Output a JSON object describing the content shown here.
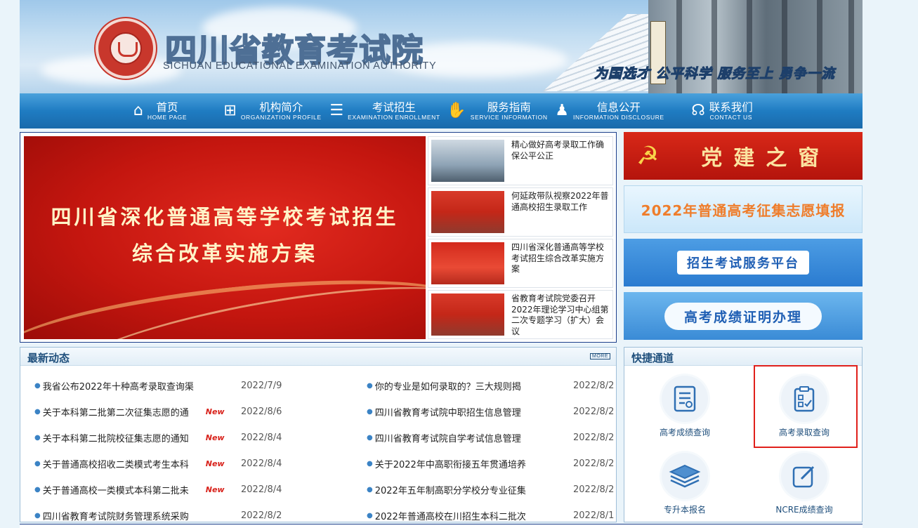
{
  "header": {
    "title": "四川省教育考试院",
    "subtitle": "SICHUAN EDUCATIONAL EXAMINATION AUTHORITY",
    "slogan": "为国选才 公平科学 服务至上 勇争一流"
  },
  "nav": [
    {
      "cn": "首页",
      "en": "HOME PAGE",
      "icon": "home-icon"
    },
    {
      "cn": "机构简介",
      "en": "ORGANIZATION PROFILE",
      "icon": "org-chart-icon"
    },
    {
      "cn": "考试招生",
      "en": "EXAMINATION ENROLLMENT",
      "icon": "document-icon"
    },
    {
      "cn": "服务指南",
      "en": "SERVICE INFORMATION",
      "icon": "handshake-icon"
    },
    {
      "cn": "信息公开",
      "en": "INFORMATION DISCLOSURE",
      "icon": "people-icon"
    },
    {
      "cn": "联系我们",
      "en": "CONTACT US",
      "icon": "headset-icon"
    }
  ],
  "carousel": {
    "line1": "四川省深化普通高等学校考试招生",
    "line2": "综合改革实施方案"
  },
  "thumbs": [
    {
      "text": "精心做好高考录取工作确保公平公正"
    },
    {
      "text": "何延政带队视察2022年普通高校招生录取工作"
    },
    {
      "text": "四川省深化普通高等学校考试招生综合改革实施方案"
    },
    {
      "text": "省教育考试院党委召开2022年理论学习中心组第二次专题学习（扩大）会议"
    }
  ],
  "banners": {
    "party": "党建之窗",
    "volunteer": "2022年普通高考征集志愿填报",
    "platform": "招生考试服务平台",
    "certificate": "高考成绩证明办理"
  },
  "latest": {
    "title": "最新动态",
    "more": "MORE",
    "left": [
      {
        "title": "我省公布2022年十种高考录取查询渠",
        "new": "",
        "date": "2022/7/9"
      },
      {
        "title": "关于本科第二批第二次征集志愿的通",
        "new": "New",
        "date": "2022/8/6"
      },
      {
        "title": "关于本科第二批院校征集志愿的通知",
        "new": "New",
        "date": "2022/8/4"
      },
      {
        "title": "关于普通高校招收二类模式考生本科",
        "new": "New",
        "date": "2022/8/4"
      },
      {
        "title": "关于普通高校一类模式本科第二批未",
        "new": "New",
        "date": "2022/8/4"
      },
      {
        "title": "四川省教育考试院财务管理系统采购",
        "new": "",
        "date": "2022/8/2"
      }
    ],
    "right": [
      {
        "title": "你的专业是如何录取的？三大规则揭",
        "date": "2022/8/2"
      },
      {
        "title": "四川省教育考试院中职招生信息管理",
        "date": "2022/8/2"
      },
      {
        "title": "四川省教育考试院自学考试信息管理",
        "date": "2022/8/2"
      },
      {
        "title": "关于2022年中高职衔接五年贯通培养",
        "date": "2022/8/2"
      },
      {
        "title": "2022年五年制高职分学校分专业征集",
        "date": "2022/8/2"
      },
      {
        "title": "2022年普通高校在川招生本科二批次",
        "date": "2022/8/1"
      }
    ]
  },
  "quick": {
    "title": "快捷通道",
    "items": [
      {
        "label": "高考成绩查询",
        "icon": "score-report-icon"
      },
      {
        "label": "高考录取查询",
        "icon": "clipboard-check-icon"
      },
      {
        "label": "专升本报名",
        "icon": "layers-icon"
      },
      {
        "label": "NCRE成绩查询",
        "icon": "edit-icon"
      }
    ]
  },
  "colors": {
    "brand_blue": "#1f7cc2",
    "banner_red": "#c4160f",
    "highlight": "#e0201b"
  }
}
